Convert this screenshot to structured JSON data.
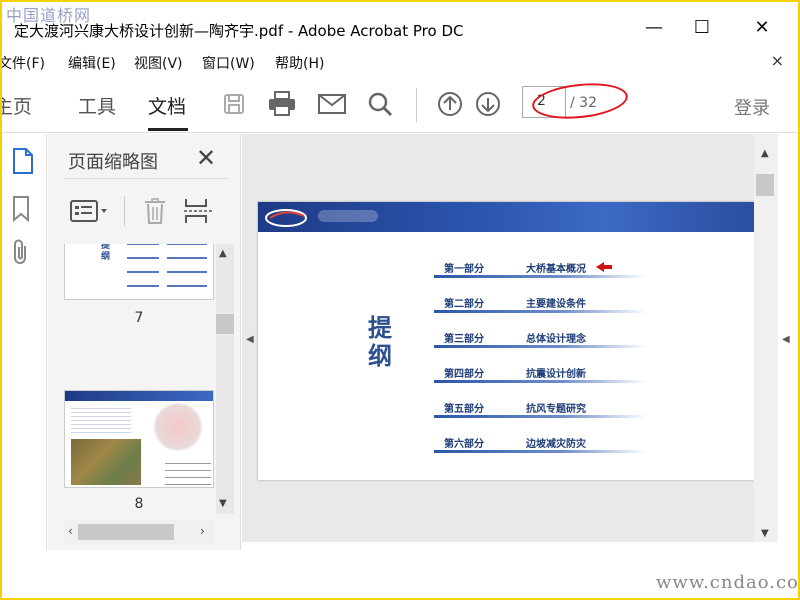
{
  "watermark_top": "中国道桥网",
  "watermark_bottom": "www.cndao.com",
  "window": {
    "title": "定大渡河兴康大桥设计创新—陶齐宇.pdf - Adobe Acrobat Pro DC",
    "minimize_glyph": "—",
    "maximize_glyph": "☐",
    "close_glyph": "✕"
  },
  "menu": {
    "items": [
      "文件(F)",
      "编辑(E)",
      "视图(V)",
      "窗口(W)",
      "帮助(H)"
    ],
    "close_glyph": "×"
  },
  "toolbar": {
    "tabs": [
      "主页",
      "工具",
      "文档"
    ],
    "active_tab": "文档",
    "current_page": "2",
    "total_pages": "/ 32",
    "login": "登录",
    "icons": [
      "save-icon",
      "print-icon",
      "email-icon",
      "search-icon",
      "page-up-icon",
      "page-down-icon"
    ]
  },
  "nav_pane": {
    "title": "页面缩略图",
    "close_glyph": "✕",
    "thumbnails": [
      {
        "page_number": "7"
      },
      {
        "page_number": "8"
      }
    ]
  },
  "slide": {
    "heading": "提纲",
    "heading_chars": [
      "提",
      "纲"
    ],
    "rows": [
      {
        "part": "第一部分",
        "desc": "大桥基本概况"
      },
      {
        "part": "第二部分",
        "desc": "主要建设条件"
      },
      {
        "part": "第三部分",
        "desc": "总体设计理念"
      },
      {
        "part": "第四部分",
        "desc": "抗震设计创新"
      },
      {
        "part": "第五部分",
        "desc": "抗风专题研究"
      },
      {
        "part": "第六部分",
        "desc": "边坡减灾防灾"
      }
    ]
  },
  "colors": {
    "frame_border": "#f2d200",
    "annotation_red": "#e0141a",
    "slide_blue": "#2c4f8e"
  }
}
